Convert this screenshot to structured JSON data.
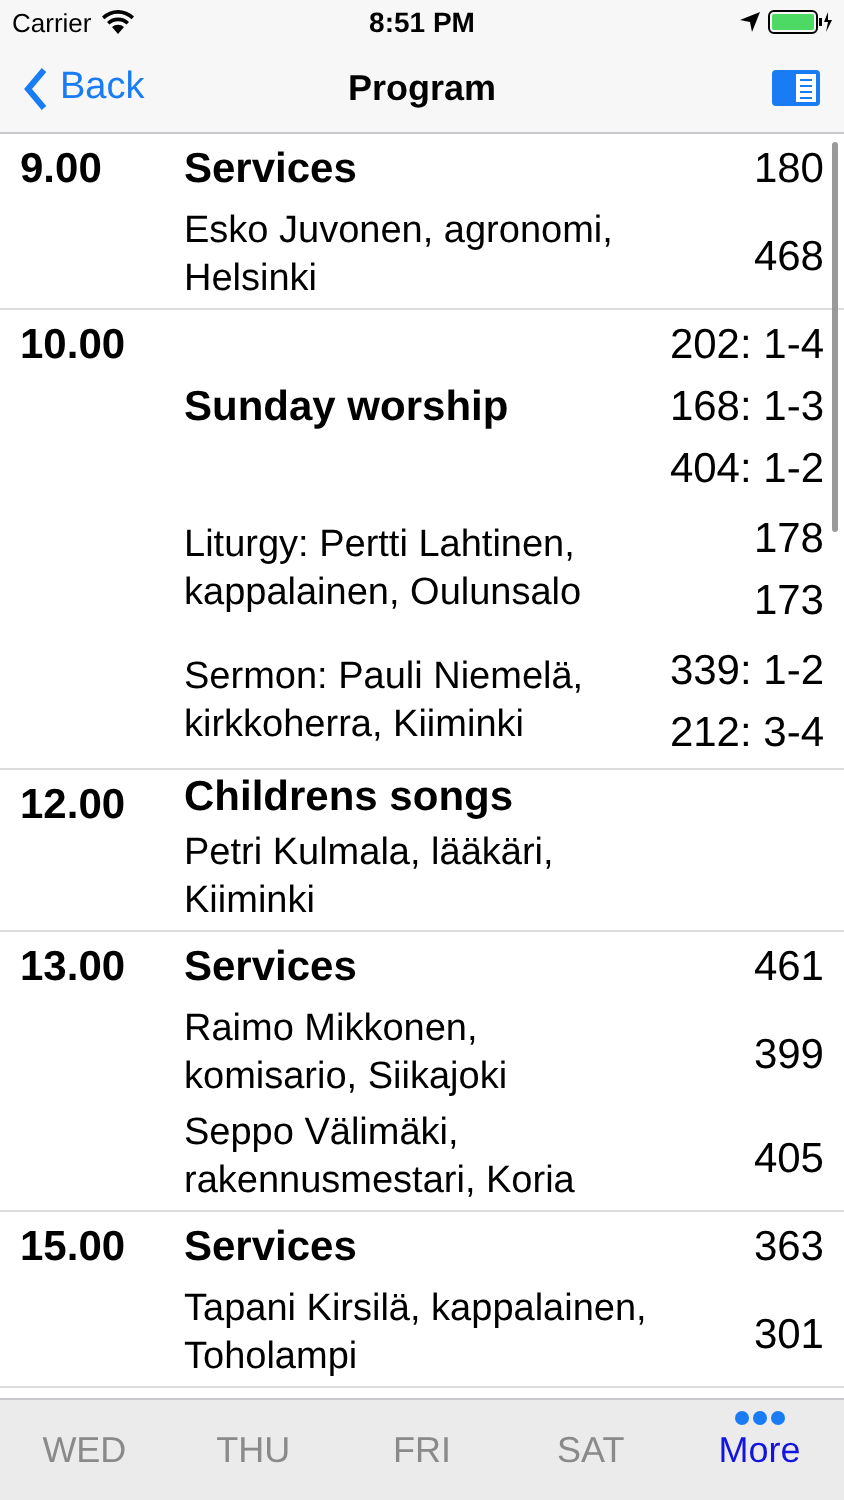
{
  "status_bar": {
    "carrier": "Carrier",
    "time": "8:51 PM"
  },
  "nav": {
    "back": "Back",
    "title": "Program"
  },
  "sections": [
    {
      "time": "9.00",
      "title": "Services",
      "title_refs": [
        "180"
      ],
      "entries": [
        {
          "text": "Esko Juvonen, agronomi, Helsinki",
          "refs": [
            "468"
          ]
        }
      ]
    },
    {
      "time": "10.00",
      "title": "Sunday worship",
      "title_refs": [
        "202: 1-4",
        "168: 1-3",
        "404: 1-2"
      ],
      "entries": [
        {
          "text": "Liturgy: Pertti Lahtinen, kappalainen, Oulunsalo",
          "refs": [
            "178",
            "173"
          ]
        },
        {
          "text": "Sermon: Pauli Niemelä, kirkkoherra, Kiiminki",
          "refs": [
            "339: 1-2",
            "212: 3-4"
          ]
        }
      ]
    },
    {
      "time": "12.00",
      "title": "Childrens songs",
      "entries": [
        {
          "text": "Petri Kulmala, lääkäri, Kiiminki"
        }
      ]
    },
    {
      "time": "13.00",
      "title": "Services",
      "title_refs": [
        "461"
      ],
      "entries": [
        {
          "text": "Raimo Mikkonen, komisario, Siikajoki",
          "refs": [
            "399"
          ]
        },
        {
          "text": "Seppo Välimäki, rakennusmestari, Koria",
          "refs": [
            "405"
          ]
        }
      ]
    },
    {
      "time": "15.00",
      "title": "Services",
      "title_refs": [
        "363"
      ],
      "entries": [
        {
          "text": "Tapani Kirsilä, kappalainen, Toholampi",
          "refs": [
            "301"
          ]
        }
      ]
    }
  ],
  "tabs": [
    {
      "label": "WED",
      "selected": false,
      "kind": "text"
    },
    {
      "label": "THU",
      "selected": false,
      "kind": "text"
    },
    {
      "label": "FRI",
      "selected": false,
      "kind": "text"
    },
    {
      "label": "SAT",
      "selected": false,
      "kind": "text"
    },
    {
      "label": "More",
      "selected": true,
      "kind": "more"
    }
  ]
}
